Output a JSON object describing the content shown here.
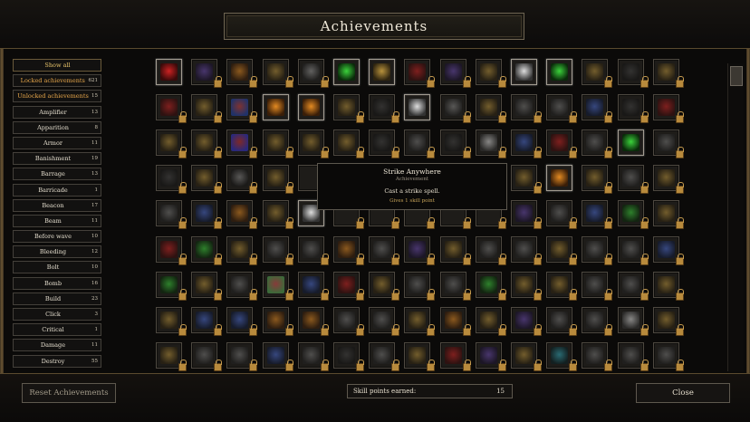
{
  "header": {
    "title": "Achievements"
  },
  "sidebar": {
    "items": [
      {
        "label": "Show all",
        "count": "",
        "state": "active"
      },
      {
        "label": "Locked achievements",
        "count": "621",
        "state": "highlight"
      },
      {
        "label": "Unlocked achievements",
        "count": "15",
        "state": "highlight"
      },
      {
        "label": "Amplifier",
        "count": "13",
        "state": ""
      },
      {
        "label": "Apparition",
        "count": "8",
        "state": ""
      },
      {
        "label": "Armor",
        "count": "11",
        "state": ""
      },
      {
        "label": "Banishment",
        "count": "19",
        "state": ""
      },
      {
        "label": "Barrage",
        "count": "13",
        "state": ""
      },
      {
        "label": "Barricade",
        "count": "1",
        "state": ""
      },
      {
        "label": "Beacon",
        "count": "17",
        "state": ""
      },
      {
        "label": "Beam",
        "count": "11",
        "state": ""
      },
      {
        "label": "Before wave",
        "count": "10",
        "state": ""
      },
      {
        "label": "Bleeding",
        "count": "12",
        "state": ""
      },
      {
        "label": "Bolt",
        "count": "10",
        "state": ""
      },
      {
        "label": "Bomb",
        "count": "16",
        "state": ""
      },
      {
        "label": "Build",
        "count": "23",
        "state": ""
      },
      {
        "label": "Click",
        "count": "3",
        "state": ""
      },
      {
        "label": "Critical",
        "count": "1",
        "state": ""
      },
      {
        "label": "Damage",
        "count": "11",
        "state": ""
      },
      {
        "label": "Destroy",
        "count": "55",
        "state": ""
      }
    ]
  },
  "tooltip": {
    "title": "Strike Anywhere",
    "subtitle": "Achievement",
    "description": "Cast a strike spell.",
    "reward": "Gives 1 skill point"
  },
  "footer": {
    "reset_label": "Reset Achievements",
    "skill_label": "Skill points earned:",
    "skill_value": "15",
    "close_label": "Close"
  },
  "colors": {
    "accent_gold": "#e6c36a",
    "lock": "#b88a3c",
    "panel_border": "#5e584e"
  },
  "grid": {
    "cells": [
      [
        "red-burst",
        "u"
      ],
      [
        "purple-triangle",
        "l"
      ],
      [
        "orange-bar",
        "l"
      ],
      [
        "gold-field",
        "l"
      ],
      [
        "ring-glyph",
        "l"
      ],
      [
        "green-square",
        "u"
      ],
      [
        "gold-cross",
        "u"
      ],
      [
        "red-sparks",
        "l"
      ],
      [
        "purple-orb",
        "l"
      ],
      [
        "gold-triangle",
        "l"
      ],
      [
        "silver-ring",
        "u"
      ],
      [
        "green-orb",
        "u"
      ],
      [
        "gold-gear",
        "l"
      ],
      [
        "dark-pyramid",
        "l"
      ],
      [
        "gold-drop",
        "l"
      ],
      [
        "red-blast",
        "l"
      ],
      [
        "gold-spikes",
        "l"
      ],
      [
        "color-dots",
        "l"
      ],
      [
        "orange-castle",
        "u"
      ],
      [
        "orange-castle2",
        "u"
      ],
      [
        "gold-eye",
        "l"
      ],
      [
        "dark-glyph",
        "l"
      ],
      [
        "silver-bolt",
        "u"
      ],
      [
        "bars",
        "l"
      ],
      [
        "gold-bar",
        "l"
      ],
      [
        "grey-spikes",
        "l"
      ],
      [
        "grey-arrow",
        "l"
      ],
      [
        "blue-shield",
        "l"
      ],
      [
        "dark-dome",
        "l"
      ],
      [
        "red-slash",
        "l"
      ],
      [
        "gold-scroll",
        "l"
      ],
      [
        "gold-cross2",
        "l"
      ],
      [
        "rgb-orb",
        "l"
      ],
      [
        "gold-book",
        "l"
      ],
      [
        "gold-dots",
        "l"
      ],
      [
        "gold-rune",
        "l"
      ],
      [
        "dark-dots",
        "l"
      ],
      [
        "grey-grid",
        "l"
      ],
      [
        "dark-arc",
        "l"
      ],
      [
        "silver-gleam",
        "l"
      ],
      [
        "blue-dots",
        "l"
      ],
      [
        "red-box",
        "l"
      ],
      [
        "grey-orb",
        "l"
      ],
      [
        "green-cup",
        "u"
      ],
      [
        "grey-cross",
        "l"
      ],
      [
        "dark-field",
        "l"
      ],
      [
        "gold-cube",
        "l"
      ],
      [
        "star-dots",
        "l"
      ],
      [
        "gold-triangle2",
        "l"
      ],
      [
        "",
        "l"
      ],
      [
        "",
        "l"
      ],
      [
        "",
        "l"
      ],
      [
        "",
        "l"
      ],
      [
        "",
        "l"
      ],
      [
        "",
        "l"
      ],
      [
        "gold-lines",
        "l"
      ],
      [
        "orange-hook",
        "u"
      ],
      [
        "gold-wave",
        "l"
      ],
      [
        "grey-frame",
        "l"
      ],
      [
        "gold-fade",
        "l"
      ],
      [
        "grey-eye",
        "l"
      ],
      [
        "blue-dots2",
        "l"
      ],
      [
        "orange-bar2",
        "l"
      ],
      [
        "gold-stick",
        "l"
      ],
      [
        "silver-sword",
        "u"
      ],
      [
        "",
        "l"
      ],
      [
        "",
        "l"
      ],
      [
        "",
        "l"
      ],
      [
        "",
        "l"
      ],
      [
        "",
        "l"
      ],
      [
        "purple-square",
        "l"
      ],
      [
        "grey-ramp",
        "l"
      ],
      [
        "blue-spiral",
        "l"
      ],
      [
        "green-triangle",
        "l"
      ],
      [
        "gold-arc",
        "l"
      ],
      [
        "red-orb",
        "l"
      ],
      [
        "green-splash",
        "l"
      ],
      [
        "gold-line",
        "l"
      ],
      [
        "grey-hearts",
        "l"
      ],
      [
        "grey-spikes2",
        "l"
      ],
      [
        "orange-drip",
        "l"
      ],
      [
        "grey-waves",
        "l"
      ],
      [
        "purple-orb2",
        "l"
      ],
      [
        "gold-web",
        "l"
      ],
      [
        "grey-x",
        "l"
      ],
      [
        "grey-bird",
        "l"
      ],
      [
        "gold-cross3",
        "l"
      ],
      [
        "grey-crown",
        "l"
      ],
      [
        "grey-cube",
        "l"
      ],
      [
        "blue-triangle",
        "l"
      ],
      [
        "green-gem",
        "l"
      ],
      [
        "gold-grass",
        "l"
      ],
      [
        "grey-dots",
        "l"
      ],
      [
        "rainbow",
        "l"
      ],
      [
        "blue-link",
        "l"
      ],
      [
        "red-star",
        "l"
      ],
      [
        "gold-urn",
        "l"
      ],
      [
        "grey-knot",
        "l"
      ],
      [
        "grey-dots2",
        "l"
      ],
      [
        "green-tree",
        "l"
      ],
      [
        "gold-moon",
        "l"
      ],
      [
        "gold-leaf",
        "l"
      ],
      [
        "grey-field",
        "l"
      ],
      [
        "grey-ring",
        "l"
      ],
      [
        "gold-chain",
        "l"
      ],
      [
        "gold-flag",
        "l"
      ],
      [
        "blue-cloud",
        "l"
      ],
      [
        "blue-bottle",
        "l"
      ],
      [
        "orange-bar3",
        "l"
      ],
      [
        "orange-box",
        "l"
      ],
      [
        "grey-wings",
        "l"
      ],
      [
        "grey-hourglass",
        "l"
      ],
      [
        "gold-swirl",
        "l"
      ],
      [
        "orange-rod",
        "l"
      ],
      [
        "gold-drum",
        "l"
      ],
      [
        "purple-orb3",
        "l"
      ],
      [
        "grey-flag",
        "l"
      ],
      [
        "grey-crack",
        "l"
      ],
      [
        "silver-tube",
        "l"
      ],
      [
        "gold-cross4",
        "l"
      ],
      [
        "gold-star",
        "l"
      ],
      [
        "grey-block",
        "l"
      ],
      [
        "grey-gloom",
        "l"
      ],
      [
        "blue-grid",
        "l"
      ],
      [
        "grey-panel",
        "l"
      ],
      [
        "dark-bolt",
        "l"
      ],
      [
        "grey-rod",
        "l"
      ],
      [
        "gold-dots2",
        "l"
      ],
      [
        "red-orb2",
        "l"
      ],
      [
        "purple-stars",
        "l"
      ],
      [
        "gold-spark",
        "l"
      ],
      [
        "teal-blob",
        "l"
      ],
      [
        "grey-streak",
        "l"
      ],
      [
        "grey-swirl",
        "l"
      ],
      [
        "grey-wing",
        "l"
      ]
    ]
  }
}
